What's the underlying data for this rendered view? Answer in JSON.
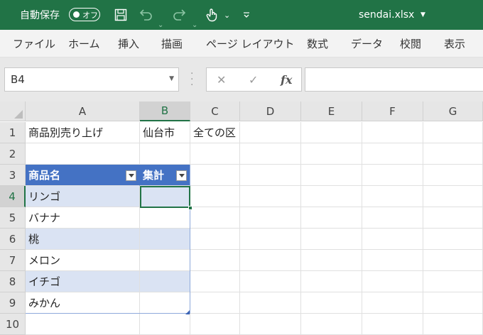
{
  "titlebar": {
    "autosave_label": "自動保存",
    "autosave_state": "オフ",
    "filename": "sendai.xlsx",
    "background": "#217346"
  },
  "ribbon": {
    "tabs": [
      "ファイル",
      "ホーム",
      "挿入",
      "描画",
      "ページ レイアウト",
      "数式",
      "データ",
      "校閲",
      "表示"
    ]
  },
  "formula_bar": {
    "name_box": "B4",
    "fx_label": "fx",
    "formula": ""
  },
  "grid": {
    "columns": [
      "A",
      "B",
      "C",
      "D",
      "E",
      "F",
      "G"
    ],
    "active_column": "B",
    "rows": [
      "1",
      "2",
      "3",
      "4",
      "5",
      "6",
      "7",
      "8",
      "9",
      "10"
    ],
    "active_row": "4",
    "cells": {
      "A1": "商品別売り上げ",
      "B1": "仙台市",
      "C1": "全ての区",
      "A3": "商品名",
      "B3": "集計",
      "A4": "リンゴ",
      "A5": "バナナ",
      "A6": "桃",
      "A7": "メロン",
      "A8": "イチゴ",
      "A9": "みかん"
    },
    "table_header_color": "#4472c4",
    "table_band_color": "#dae3f3",
    "selection_color": "#217346"
  }
}
